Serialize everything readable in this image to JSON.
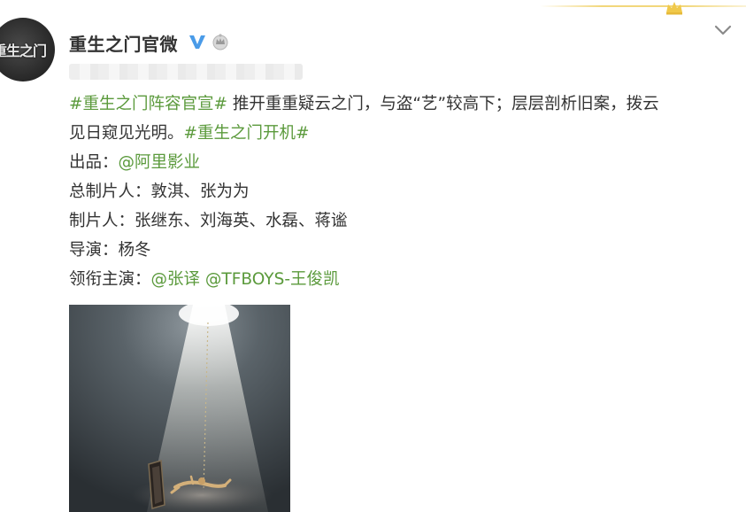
{
  "post": {
    "author": {
      "name": "重生之门官微",
      "avatar_text": "重生之门"
    },
    "text": {
      "line1_tag": "#重生之门阵容官宣#",
      "line1_rest": " 推开重重疑云之门，与盗“艺”较高下；层层剖析旧案，拨云",
      "line2_text": "见日窥见光明。",
      "line2_tag": "#重生之门开机#",
      "producer_label": "出品：",
      "producer_mention": "@阿里影业",
      "chief_producer_label": "总制片人：",
      "chief_producer_value": "敦淇、张为为",
      "producer2_label": "制片人：",
      "producer2_value": "张继东、刘海英、水磊、蒋谧",
      "director_label": "导演：",
      "director_value": "杨冬",
      "lead_label": "领衔主演：",
      "lead_mention_1": "@张译",
      "lead_mention_2": "@TFBOYS-王俊凯"
    },
    "icons": {
      "verified": "verified-v-icon",
      "vip": "vip-crown-icon",
      "more": "chevron-down-icon"
    },
    "colors": {
      "link": "#5b9a3c",
      "text": "#333333",
      "verified": "#4a9be8"
    }
  }
}
